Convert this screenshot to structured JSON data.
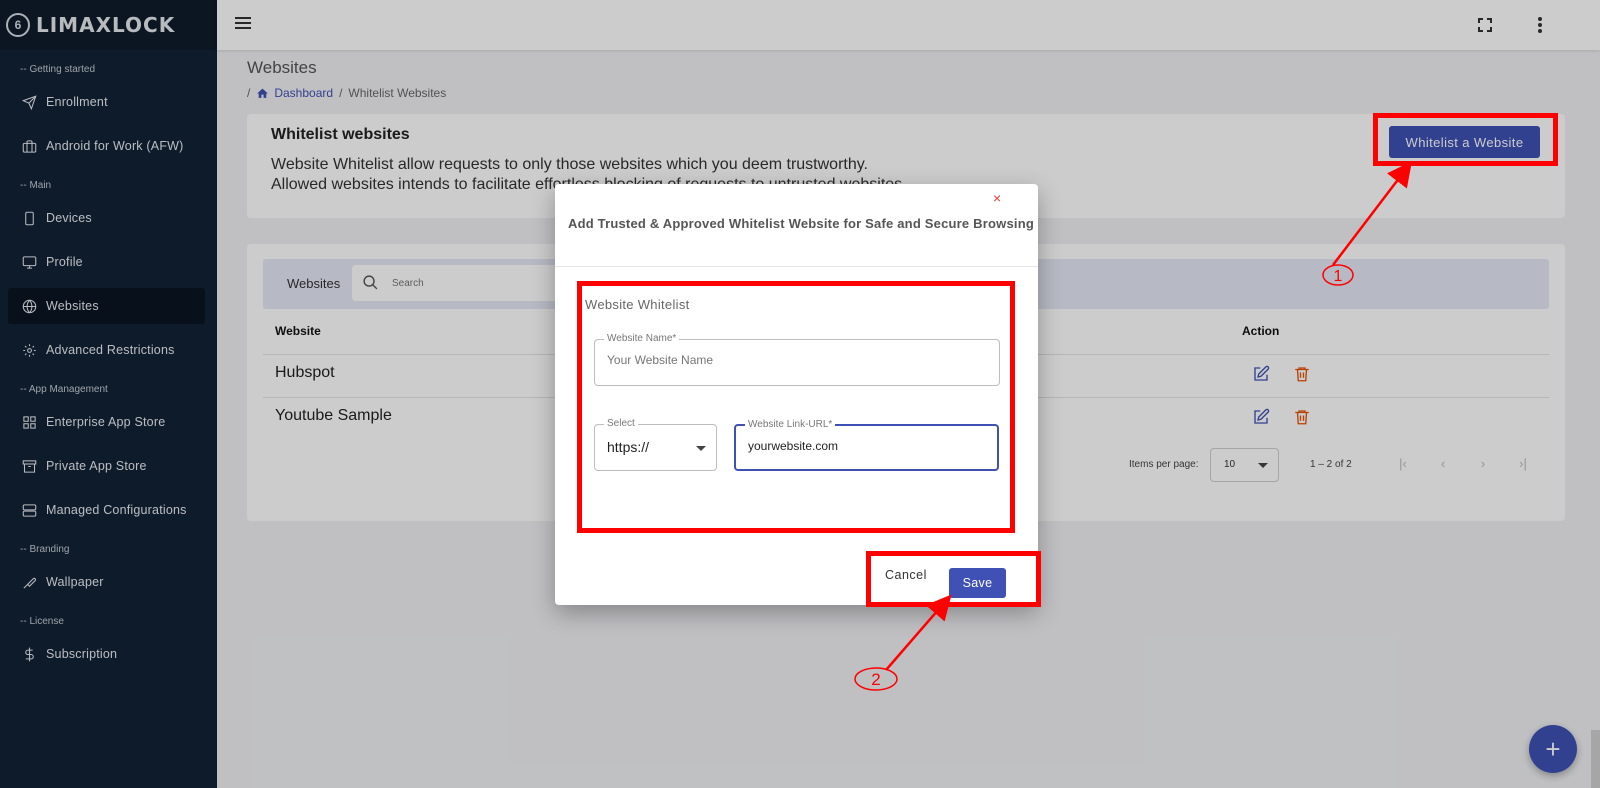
{
  "brand": {
    "name": "LIMAXLOCK",
    "mark": "6"
  },
  "sidebar": {
    "sections": [
      "-- Getting started",
      "-- Main",
      "-- App Management",
      "-- Branding",
      "-- License"
    ],
    "items": [
      {
        "label": "Enrollment",
        "icon": "send-icon"
      },
      {
        "label": "Android for Work (AFW)",
        "icon": "briefcase-icon"
      },
      {
        "label": "Devices",
        "icon": "smartphone-icon"
      },
      {
        "label": "Profile",
        "icon": "monitor-icon"
      },
      {
        "label": "Websites",
        "icon": "globe-icon",
        "active": true
      },
      {
        "label": "Advanced Restrictions",
        "icon": "gear-icon"
      },
      {
        "label": "Enterprise App Store",
        "icon": "grid-icon"
      },
      {
        "label": "Private App Store",
        "icon": "archive-icon"
      },
      {
        "label": "Managed Configurations",
        "icon": "server-icon"
      },
      {
        "label": "Wallpaper",
        "icon": "brush-icon"
      },
      {
        "label": "Subscription",
        "icon": "dollar-icon"
      }
    ]
  },
  "page": {
    "title": "Websites",
    "breadcrumb": {
      "sep": "/",
      "home": "Dashboard",
      "current": "Whitelist Websites"
    }
  },
  "whitelist_card": {
    "heading": "Whitelist websites",
    "line1": "Website Whitelist allow requests to only those websites which you deem trustworthy.",
    "line2": "Allowed websites intends to facilitate effortless blocking of requests to untrusted websites.",
    "button": "Whitelist a Website"
  },
  "table": {
    "label": "Websites",
    "search_placeholder": "Search",
    "columns": [
      "Website",
      "Action"
    ],
    "rows": [
      {
        "website": "Hubspot"
      },
      {
        "website": "Youtube Sample"
      }
    ],
    "items_per_page_label": "Items per page:",
    "items_per_page": "10",
    "range": "1 – 2 of 2"
  },
  "modal": {
    "close": "×",
    "title": "Add Trusted & Approved Whitelist Website for Safe and Secure Browsing",
    "legend": "Website Whitelist",
    "name_label": "Website Name*",
    "name_placeholder": "Your Website Name",
    "select_label": "Select",
    "select_value": "https://",
    "url_label": "Website Link-URL*",
    "url_value": "yourwebsite.com",
    "cancel": "Cancel",
    "save": "Save"
  },
  "annotations": {
    "step1": "1",
    "step2": "2",
    "color": "#ff0000"
  },
  "fab": "+",
  "colors": {
    "primary": "#3f51b5",
    "sidebar": "#122236",
    "delete": "#e65100"
  }
}
